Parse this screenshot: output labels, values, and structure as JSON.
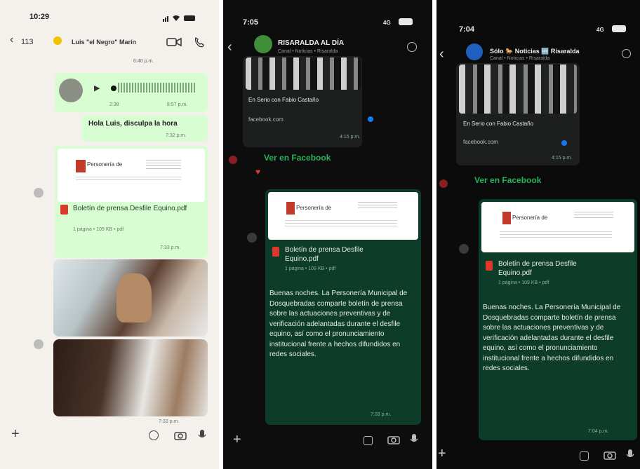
{
  "panel1": {
    "status_time": "10:29",
    "back_count": "113",
    "contact_name": "Luis \"el Negro\" Marín",
    "date_stamp": "6:40 p.m.",
    "voice": {
      "duration": "2:38",
      "time": "8:57 p.m."
    },
    "text_msg": {
      "text": "Hola Luis, disculpa la hora",
      "time": "7:32 p.m."
    },
    "doc": {
      "logo_text": "Personería de",
      "name": "Boletín de prensa Desfile Equino.pdf",
      "meta": "1 página • 109 KB • pdf",
      "time": "7:33 p.m."
    },
    "photos_time": "7:33 p.m."
  },
  "panel2": {
    "status_time": "7:05",
    "network": "4G",
    "channel_name": "RISARALDA AL DÍA",
    "channel_sub": "Canal • Noticias • Risaralda",
    "caption": "En Serio con Fabio Castaño",
    "link": "facebook.com",
    "link_time": "4:15 p.m.",
    "fb_button": "Ver en Facebook",
    "doc": {
      "logo_text": "Personería de",
      "name": "Boletín de prensa Desfile Equino.pdf",
      "meta": "1 página • 109 KB • pdf"
    },
    "message": "Buenas noches. La Personería Municipal de Dosquebradas comparte boletín de prensa sobre las actuaciones preventivas y de verificación adelantadas durante el desfile equino, así como el pronunciamiento institucional frente a hechos difundidos en redes sociales.",
    "msg_time": "7:03 p.m."
  },
  "panel3": {
    "status_time": "7:04",
    "network": "4G",
    "channel_name": "Sólo 🐎 Noticias 🆕 Risaralda",
    "channel_sub": "Canal • Noticias • Risaralda",
    "caption": "En Serio con Fabio Castaño",
    "link": "facebook.com",
    "link_time": "4:15 p.m.",
    "fb_button": "Ver en Facebook",
    "doc": {
      "logo_text": "Personería de",
      "name": "Boletín de prensa Desfile Equino.pdf",
      "meta": "1 página • 109 KB • pdf"
    },
    "message": "Buenas noches. La Personería Municipal de Dosquebradas comparte boletín de prensa sobre las actuaciones preventivas y de verificación adelantadas durante el desfile equino, así como el pronunciamiento institucional frente a hechos difundidos en redes sociales.",
    "msg_time": "7:04 p.m."
  },
  "colors": {
    "light_bubble": "#d9fdd3",
    "dark_bubble": "#0d3d28",
    "whatsapp_green": "#27b35c",
    "pdf_red": "#d93a2b"
  }
}
